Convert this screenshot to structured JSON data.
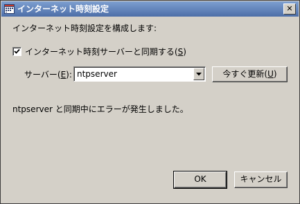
{
  "window": {
    "title": "インターネット時刻設定",
    "close_label": "✕"
  },
  "intro_text": "インターネット時刻設定を構成します:",
  "sync_checkbox": {
    "checked": true,
    "label_prefix": "インターネット時刻サーバーと同期する(",
    "accel": "S",
    "label_suffix": ")"
  },
  "server": {
    "label_prefix": "サーバー(",
    "accel": "E",
    "label_suffix": "):",
    "value": "ntpserver"
  },
  "update_button": {
    "label_prefix": "今すぐ更新(",
    "accel": "U",
    "label_suffix": ")"
  },
  "status_text": "ntpserver と同期中にエラーが発生しました。",
  "ok_button": {
    "label": "OK"
  },
  "cancel_button": {
    "label": "キャンセル"
  },
  "icons": {
    "title": "clock-calendar-icon",
    "check": "checkmark-icon",
    "dropdown": "chevron-down-icon"
  }
}
